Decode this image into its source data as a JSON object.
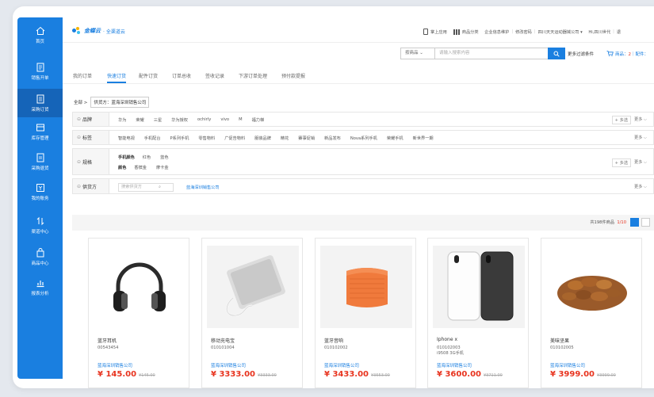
{
  "sidebar": {
    "items": [
      {
        "label": "首页",
        "icon": "home-icon"
      },
      {
        "label": "销售开单",
        "icon": "sales-order-icon"
      },
      {
        "label": "采购订货",
        "icon": "purchase-icon"
      },
      {
        "label": "库存管理",
        "icon": "inventory-icon"
      },
      {
        "label": "采购退货",
        "icon": "return-icon"
      },
      {
        "label": "我的账务",
        "icon": "finance-icon"
      },
      {
        "label": "渠道中心",
        "icon": "channel-icon"
      },
      {
        "label": "商品中心",
        "icon": "goods-icon"
      },
      {
        "label": "报表分析",
        "icon": "report-icon"
      }
    ]
  },
  "header": {
    "logo_text": "金蝶云",
    "logo_sub": "· 全渠道云",
    "links": [
      "掌上应用",
      "商品分类",
      "企业信息维护",
      "修改密码",
      "四川天天运动器械公司 ▾",
      "Hi,四川世代",
      "退"
    ]
  },
  "search": {
    "select_label": "按商品 ⌄",
    "placeholder": "请输入搜索内容",
    "more_filter": "更多过滤条件",
    "cart_label": "商品：",
    "cart_count": "2",
    "cart_piece_label": "｜配件："
  },
  "tabs": [
    "我的订单",
    "快速订货",
    "配件订货",
    "订单总收",
    "签收记录",
    "下游订单处理",
    "预付款提报"
  ],
  "breadcrumb": {
    "root": "全部 >",
    "tag": "供货方：蓝海深圳销售公司"
  },
  "filters": {
    "brand": {
      "label": "品牌",
      "options": [
        "华为",
        "荣耀",
        "三星",
        "华为授权",
        "ochirly",
        "vivo",
        "M",
        "福力梯"
      ],
      "multi": "+ 多选",
      "more": "更多 ⌵"
    },
    "tags": {
      "label": "标签",
      "options": [
        "智能电视",
        "手机配台",
        "P系列手机",
        "零售物料",
        "广促告物料",
        "服装品牌",
        "精花",
        "賽事促销",
        "新品发布",
        "Nova系列手机",
        "荣耀手机",
        "新世界一期"
      ],
      "more": "更多 ⌵"
    },
    "spec": {
      "label": "规格",
      "row1": {
        "name": "手机颜色",
        "values": [
          "红色",
          "蓝色"
        ]
      },
      "row2": {
        "name": "颜色",
        "values": [
          "香槟金",
          "摩卡金"
        ]
      },
      "multi": "+ 多选",
      "more": "更多 ⌵"
    },
    "supplier": {
      "label": "供货方",
      "placeholder": "搜索供货方",
      "value": "蓝海深圳销售公司",
      "more": "更多 ⌵"
    }
  },
  "list": {
    "count_prefix": "共",
    "count": "198",
    "count_suffix": "件商品",
    "page": "1/10"
  },
  "products": [
    {
      "name": "蓝牙耳机",
      "code": "00543454",
      "code2": "",
      "supplier": "蓝海深圳销售公司",
      "price": "¥ 145.00",
      "old_price": "¥145.00",
      "image": "headphones"
    },
    {
      "name": "移动充电宝",
      "code": "010101004",
      "code2": "",
      "supplier": "蓝海深圳销售公司",
      "price": "¥ 3333.00",
      "old_price": "¥3333.00",
      "image": "power-bank"
    },
    {
      "name": "蓝牙音响",
      "code": "010102002",
      "code2": "",
      "supplier": "蓝海深圳销售公司",
      "price": "¥ 3433.00",
      "old_price": "¥3553.00",
      "image": "speaker"
    },
    {
      "name": "Iphone x",
      "code": "010102003",
      "code2": "i9508 3G手机",
      "supplier": "蓝海深圳销售公司",
      "price": "¥ 3600.00",
      "old_price": "¥3711.00",
      "image": "phones"
    },
    {
      "name": "美味坚果",
      "code": "010102005",
      "code2": "",
      "supplier": "蓝海深圳销售公司",
      "price": "¥ 3999.00",
      "old_price": "¥3999.00",
      "image": "nuts"
    }
  ],
  "colors": {
    "accent": "#1a7fe0",
    "price": "#e8341f",
    "sidebar": "#1a7fe0"
  }
}
